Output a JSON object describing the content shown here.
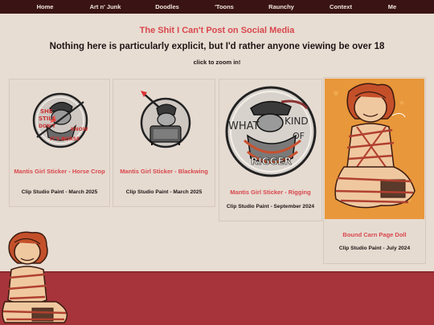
{
  "nav": {
    "items": [
      "Home",
      "Art n' Junk",
      "Doodles",
      "'Toons",
      "Raunchy",
      "Context",
      "Me"
    ]
  },
  "page": {
    "title": "The Shit I Can't Post on Social Media",
    "subtitle": "Nothing here is particularly explicit, but I'd rather anyone viewing be over 18",
    "zoom_hint": "click to zoom in!"
  },
  "gallery": [
    {
      "title": "Mantis Girl Sticker - Horse Crop",
      "meta": "Clip Studio Paint - March 2025",
      "sticker_text": [
        "SHE",
        "STILL",
        "DON'T",
        "KNOW",
        "IT'S A",
        "HORSE"
      ]
    },
    {
      "title": "Mantis Girl Sticker - Blackwing",
      "meta": "Clip Studio Paint - March 2025"
    },
    {
      "title": "Mantis Girl Sticker - Rigging",
      "meta": "Clip Studio Paint - September 2024",
      "sticker_text": [
        "WHAT",
        "KIND",
        "OF",
        "RIGGER"
      ]
    },
    {
      "title": "Bound Carn Page Doll",
      "meta": "Clip Studio Paint - July 2024"
    }
  ],
  "colors": {
    "nav_bg": "#3a1414",
    "page_bg": "#e8ddd3",
    "accent": "#d9474d",
    "band": "#a6343a",
    "card4_bg": "#e8973b"
  }
}
